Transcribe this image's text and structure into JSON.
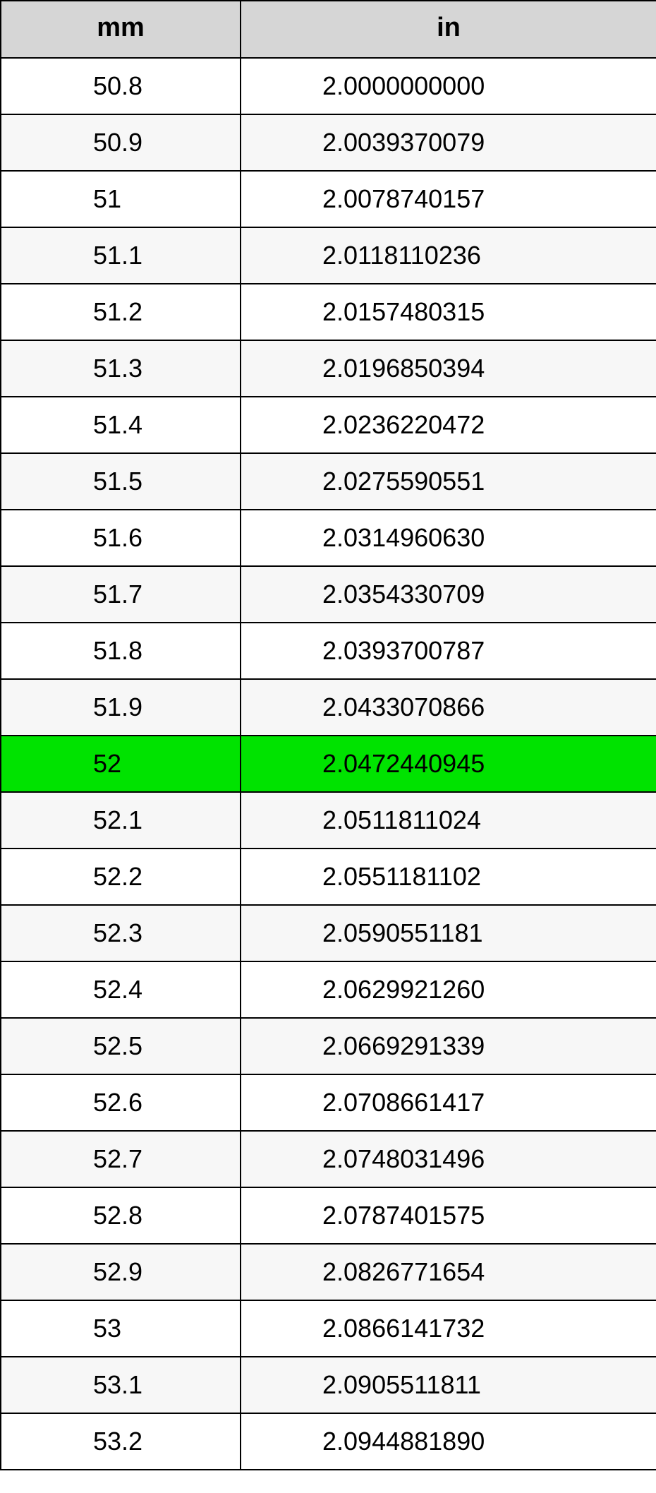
{
  "headers": {
    "mm": "mm",
    "in": "in"
  },
  "highlight_mm": "52",
  "rows": [
    {
      "mm": "50.8",
      "in": "2.0000000000"
    },
    {
      "mm": "50.9",
      "in": "2.0039370079"
    },
    {
      "mm": "51",
      "in": "2.0078740157"
    },
    {
      "mm": "51.1",
      "in": "2.0118110236"
    },
    {
      "mm": "51.2",
      "in": "2.0157480315"
    },
    {
      "mm": "51.3",
      "in": "2.0196850394"
    },
    {
      "mm": "51.4",
      "in": "2.0236220472"
    },
    {
      "mm": "51.5",
      "in": "2.0275590551"
    },
    {
      "mm": "51.6",
      "in": "2.0314960630"
    },
    {
      "mm": "51.7",
      "in": "2.0354330709"
    },
    {
      "mm": "51.8",
      "in": "2.0393700787"
    },
    {
      "mm": "51.9",
      "in": "2.0433070866"
    },
    {
      "mm": "52",
      "in": "2.0472440945"
    },
    {
      "mm": "52.1",
      "in": "2.0511811024"
    },
    {
      "mm": "52.2",
      "in": "2.0551181102"
    },
    {
      "mm": "52.3",
      "in": "2.0590551181"
    },
    {
      "mm": "52.4",
      "in": "2.0629921260"
    },
    {
      "mm": "52.5",
      "in": "2.0669291339"
    },
    {
      "mm": "52.6",
      "in": "2.0708661417"
    },
    {
      "mm": "52.7",
      "in": "2.0748031496"
    },
    {
      "mm": "52.8",
      "in": "2.0787401575"
    },
    {
      "mm": "52.9",
      "in": "2.0826771654"
    },
    {
      "mm": "53",
      "in": "2.0866141732"
    },
    {
      "mm": "53.1",
      "in": "2.0905511811"
    },
    {
      "mm": "53.2",
      "in": "2.0944881890"
    }
  ]
}
